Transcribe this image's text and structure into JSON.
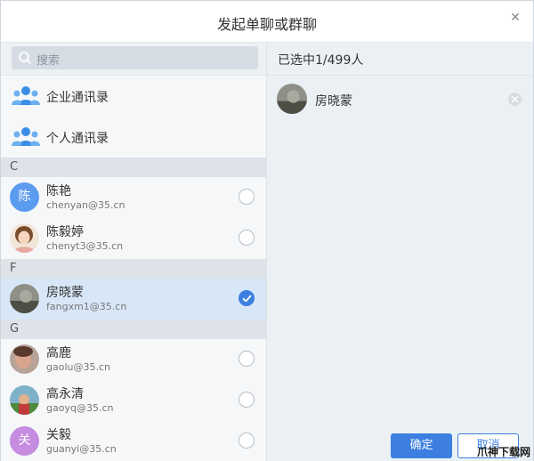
{
  "dialog": {
    "title": "发起单聊或群聊"
  },
  "search": {
    "placeholder": "搜索",
    "icon": "search-icon"
  },
  "directories": [
    {
      "label": "企业通讯录",
      "icon": "people-group-icon"
    },
    {
      "label": "个人通讯录",
      "icon": "people-group-icon"
    }
  ],
  "sections": [
    {
      "letter": "C"
    },
    {
      "letter": "F"
    },
    {
      "letter": "G"
    }
  ],
  "contacts": [
    {
      "name": "陈艳",
      "email": "chenyan@35.cn",
      "avatar_text": "陈",
      "selected": false
    },
    {
      "name": "陈毅婷",
      "email": "chenyt3@35.cn",
      "avatar_text": "",
      "selected": false
    },
    {
      "name": "房晓蒙",
      "email": "fangxm1@35.cn",
      "avatar_text": "",
      "selected": true
    },
    {
      "name": "高鹿",
      "email": "gaolu@35.cn",
      "avatar_text": "",
      "selected": false
    },
    {
      "name": "高永清",
      "email": "gaoyq@35.cn",
      "avatar_text": "",
      "selected": false
    },
    {
      "name": "关毅",
      "email": "guanyi@35.cn",
      "avatar_text": "关",
      "selected": false
    }
  ],
  "right_panel": {
    "selected_count_label": "已选中1/499人",
    "selected": [
      {
        "name": "房晓蒙"
      }
    ]
  },
  "buttons": {
    "ok": "确定",
    "cancel": "取消"
  },
  "watermark": "爪神下载网",
  "colors": {
    "accent": "#3c7fe0",
    "selected_row": "#d8e7f7",
    "section_bg": "#dde3e9"
  }
}
